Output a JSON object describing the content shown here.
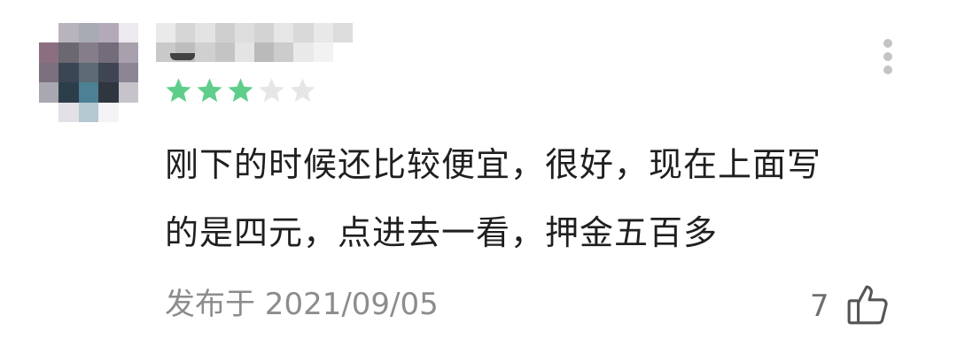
{
  "review": {
    "rating": 3,
    "rating_max": 5,
    "text_lines": [
      "刚下的时候还比较便宜，很好，现在上面写",
      "的是四元，点进去一看，押金五百多"
    ],
    "posted_at": "发布于 2021/09/05",
    "like_count": "7"
  },
  "icons": {
    "star_filled_color": "#5fce8a",
    "star_empty_color": "#e6e6e6",
    "more": "more-vertical-icon",
    "like": "thumbs-up-icon"
  }
}
